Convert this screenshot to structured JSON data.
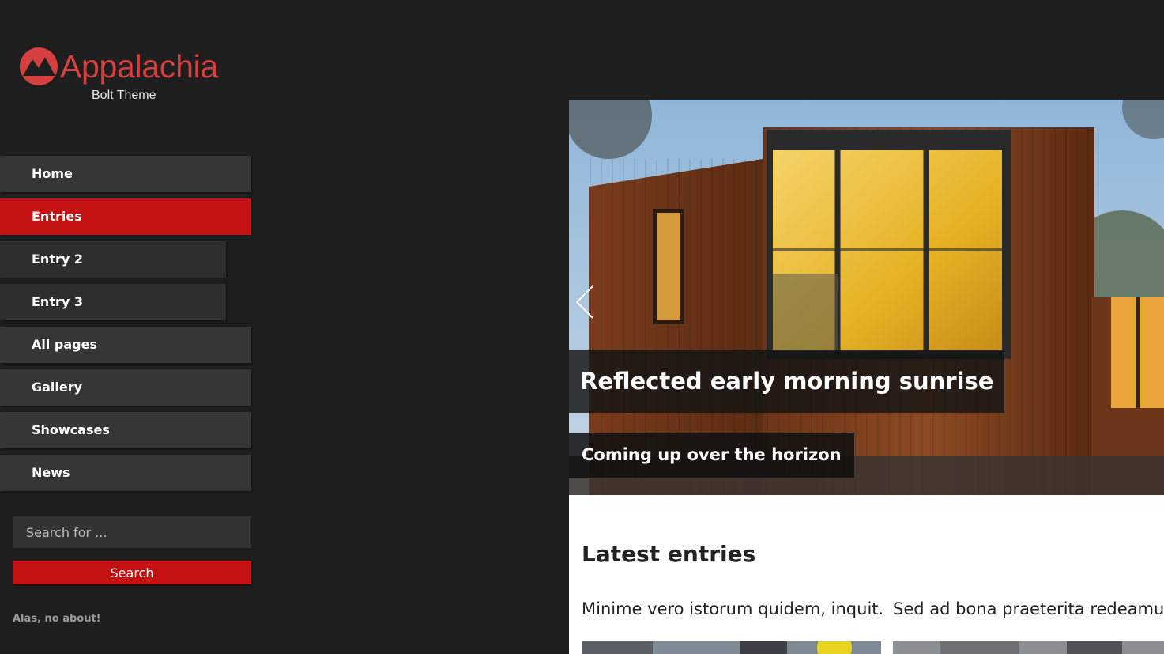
{
  "site": {
    "logo_name": "Appalachia",
    "logo_tagline": "Bolt Theme",
    "logo_icon": "mountain-circle-icon",
    "brand_color": "#d64040"
  },
  "nav": {
    "items": [
      {
        "label": "Home",
        "active": false,
        "level": 1
      },
      {
        "label": "Entries",
        "active": true,
        "level": 1
      },
      {
        "label": "Entry 2",
        "active": false,
        "level": 2
      },
      {
        "label": "Entry 3",
        "active": false,
        "level": 2
      },
      {
        "label": "All pages",
        "active": false,
        "level": 1
      },
      {
        "label": "Gallery",
        "active": false,
        "level": 1
      },
      {
        "label": "Showcases",
        "active": false,
        "level": 1
      },
      {
        "label": "News",
        "active": false,
        "level": 1
      }
    ],
    "active_color": "#c41111"
  },
  "search": {
    "placeholder": "Search for ...",
    "value": "",
    "button_label": "Search"
  },
  "about_text": "Alas, no about!",
  "slider": {
    "title": "Reflected early morning sunrise",
    "subtitle": "Coming up over the horizon",
    "prev_icon": "chevron-left-icon"
  },
  "latest": {
    "heading": "Latest entries",
    "entries": [
      {
        "title": "Minime vero istorum quidem, inquit."
      },
      {
        "title": "Sed ad bona praeterita redeamus."
      }
    ]
  }
}
